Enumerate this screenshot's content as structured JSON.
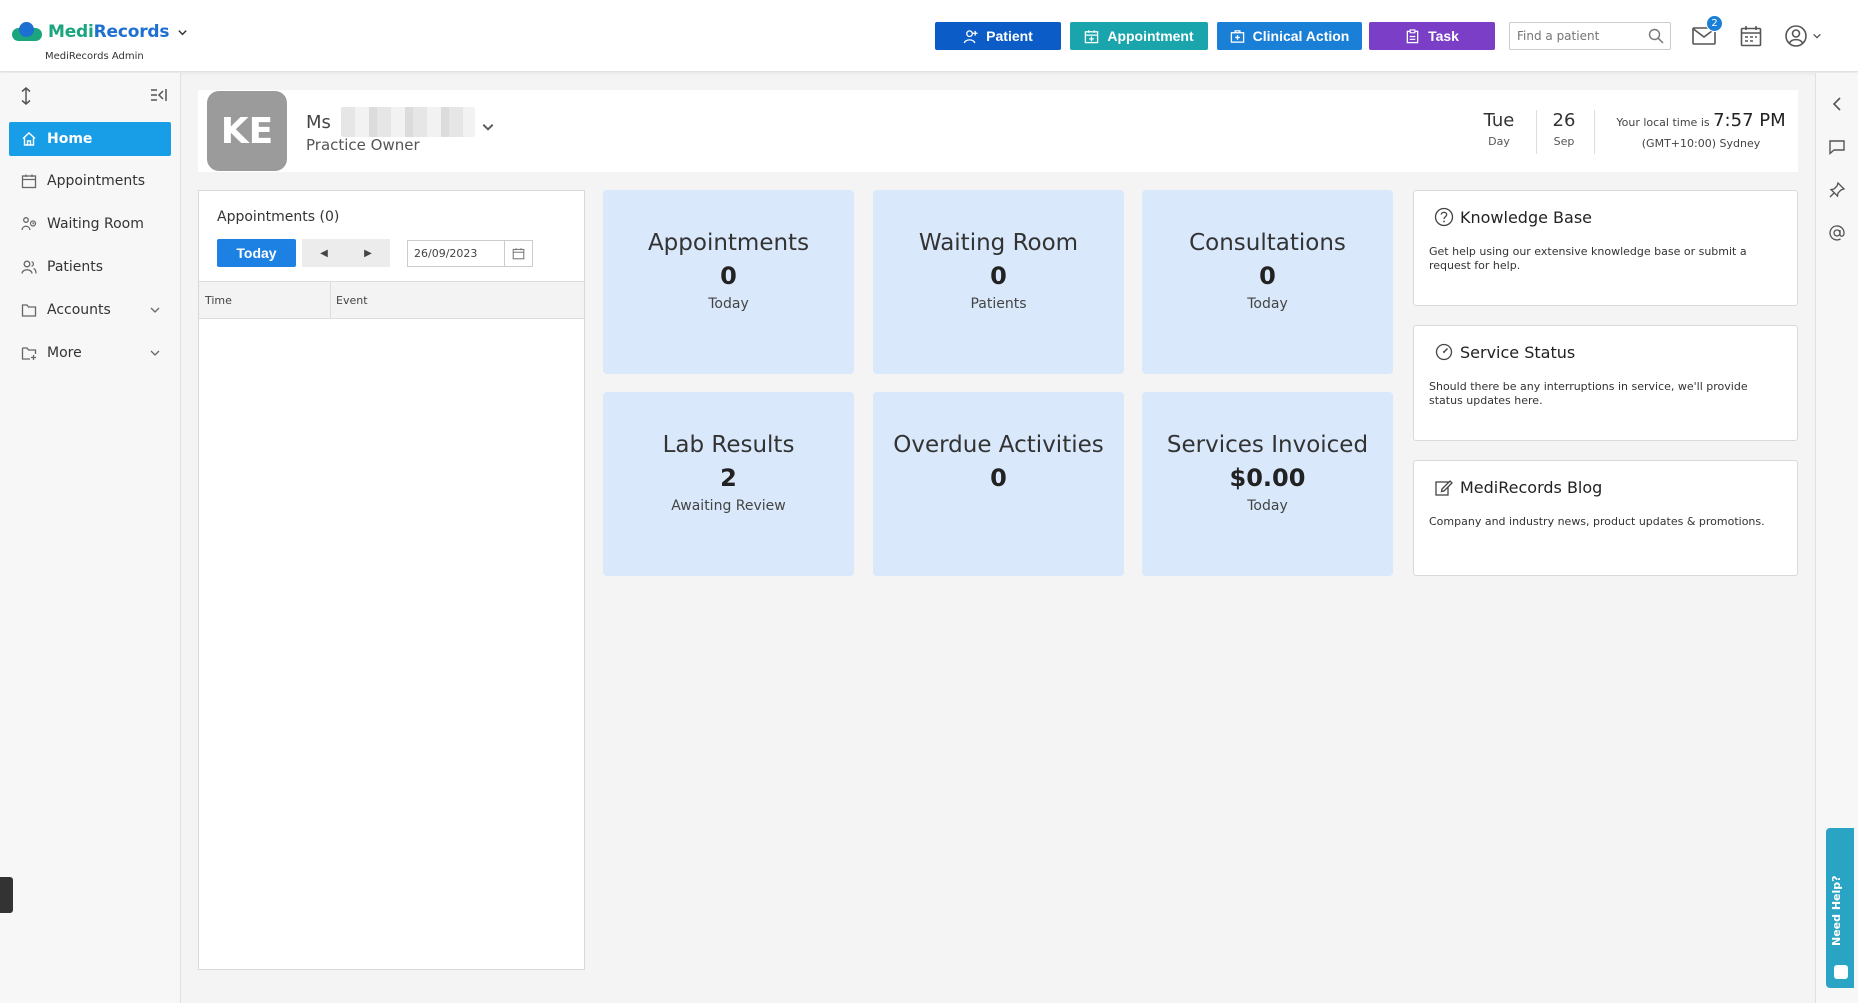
{
  "header": {
    "logo_medi": "Medi",
    "logo_records": "Records",
    "subtitle": "MediRecords Admin",
    "buttons": {
      "patient": "Patient",
      "appointment": "Appointment",
      "clinical_action": "Clinical Action",
      "task": "Task"
    },
    "search_placeholder": "Find a patient",
    "mail_badge": "2"
  },
  "sidebar": {
    "items": [
      {
        "label": "Home",
        "icon": "home-icon",
        "active": true
      },
      {
        "label": "Appointments",
        "icon": "calendar-icon"
      },
      {
        "label": "Waiting Room",
        "icon": "waiting-icon"
      },
      {
        "label": "Patients",
        "icon": "users-icon"
      },
      {
        "label": "Accounts",
        "icon": "folder-icon"
      },
      {
        "label": "More",
        "icon": "folder-plus-icon"
      }
    ]
  },
  "profile": {
    "initials": "KE",
    "salutation": "Ms",
    "role": "Practice Owner",
    "day_value": "Tue",
    "day_label": "Day",
    "date_value": "26",
    "date_label": "Sep",
    "time_prefix": "Your local time is",
    "time_value": "7:57 PM",
    "timezone": "(GMT+10:00) Sydney"
  },
  "appointments_panel": {
    "title": "Appointments (0)",
    "today_button": "Today",
    "date_value": "26/09/2023",
    "columns": [
      "Time",
      "Event"
    ]
  },
  "stats": [
    {
      "title": "Appointments",
      "value": "0",
      "sub": "Today"
    },
    {
      "title": "Waiting Room",
      "value": "0",
      "sub": "Patients"
    },
    {
      "title": "Consultations",
      "value": "0",
      "sub": "Today"
    },
    {
      "title": "Lab Results",
      "value": "2",
      "sub": "Awaiting Review"
    },
    {
      "title": "Overdue Activities",
      "value": "0",
      "sub": ""
    },
    {
      "title": "Services Invoiced",
      "value": "$0.00",
      "sub": "Today"
    }
  ],
  "cards": [
    {
      "title": "Knowledge Base",
      "desc": "Get help using our extensive knowledge base or submit a request for help.",
      "icon": "help-icon"
    },
    {
      "title": "Service Status",
      "desc": "Should there be any interruptions in service, we'll provide status updates here.",
      "icon": "gauge-icon"
    },
    {
      "title": "MediRecords Blog",
      "desc": "Company and industry news, product updates & promotions.",
      "icon": "edit-icon"
    }
  ],
  "help_tab": "Need Help?",
  "colors": {
    "brand_green": "#1aa57f",
    "brand_blue": "#1d6fd1",
    "patient_btn": "#0b5cc7",
    "appointment_btn": "#1aa5ad",
    "clinical_btn": "#1a7fd6",
    "task_btn": "#7b3fc7",
    "nav_active": "#189ee6",
    "stat_bg": "#d9e9fb"
  }
}
